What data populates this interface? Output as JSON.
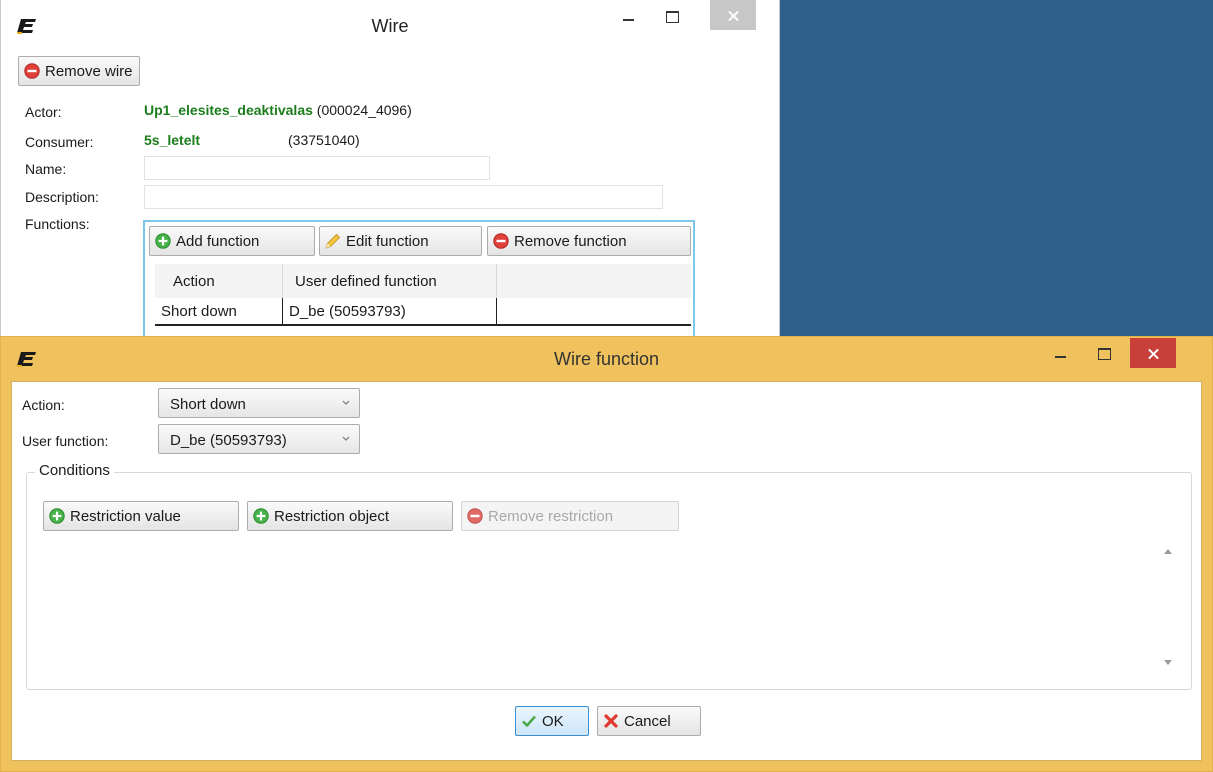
{
  "desktop": {
    "background": "#2d5f8a"
  },
  "wire_window": {
    "title": "Wire",
    "remove_wire_label": "Remove wire",
    "actor_label": "Actor:",
    "actor_name": "Up1_elesites_deaktivalas",
    "actor_id": "(000024_4096)",
    "consumer_label": "Consumer:",
    "consumer_name": "5s_letelt",
    "consumer_id": "(33751040)",
    "name_label": "Name:",
    "name_value": "",
    "description_label": "Description:",
    "description_value": "",
    "functions_label": "Functions:",
    "add_function_label": "Add function",
    "edit_function_label": "Edit function",
    "remove_function_label": "Remove function",
    "grid": {
      "columns": [
        "Action",
        "User defined function"
      ],
      "rows": [
        [
          "Short down",
          "D_be (50593793)"
        ]
      ]
    },
    "close_button_color": "#c7c7c7"
  },
  "wire_function_window": {
    "title": "Wire function",
    "action_label": "Action:",
    "action_value": "Short down",
    "user_function_label": "User function:",
    "user_function_value": "D_be (50593793)",
    "conditions_label": "Conditions",
    "restriction_value_label": "Restriction value",
    "restriction_object_label": "Restriction object",
    "remove_restriction_label": "Remove restriction",
    "ok_label": "OK",
    "cancel_label": "Cancel",
    "frame_color": "#f0c25e",
    "close_button_color": "#c9403b"
  }
}
